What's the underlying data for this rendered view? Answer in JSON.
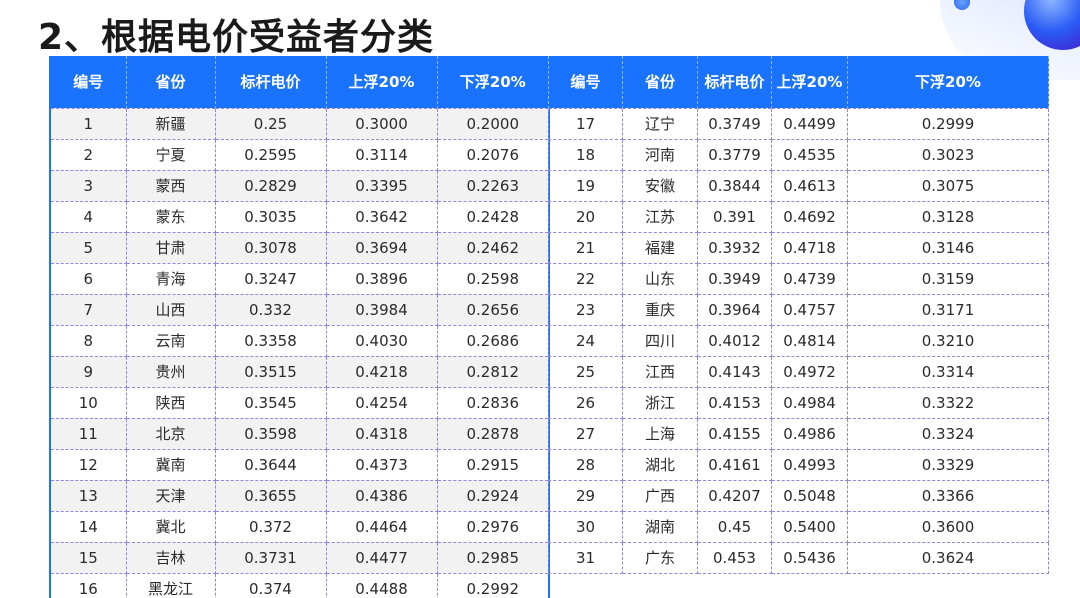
{
  "page": {
    "title": "2、根据电价受益者分类"
  },
  "table_left": {
    "headers": [
      "编号",
      "省份",
      "标杆电价",
      "上浮20%",
      "下浮20%"
    ],
    "rows": [
      [
        "1",
        "新疆",
        "0.25",
        "0.3000",
        "0.2000"
      ],
      [
        "2",
        "宁夏",
        "0.2595",
        "0.3114",
        "0.2076"
      ],
      [
        "3",
        "蒙西",
        "0.2829",
        "0.3395",
        "0.2263"
      ],
      [
        "4",
        "蒙东",
        "0.3035",
        "0.3642",
        "0.2428"
      ],
      [
        "5",
        "甘肃",
        "0.3078",
        "0.3694",
        "0.2462"
      ],
      [
        "6",
        "青海",
        "0.3247",
        "0.3896",
        "0.2598"
      ],
      [
        "7",
        "山西",
        "0.332",
        "0.3984",
        "0.2656"
      ],
      [
        "8",
        "云南",
        "0.3358",
        "0.4030",
        "0.2686"
      ],
      [
        "9",
        "贵州",
        "0.3515",
        "0.4218",
        "0.2812"
      ],
      [
        "10",
        "陕西",
        "0.3545",
        "0.4254",
        "0.2836"
      ],
      [
        "11",
        "北京",
        "0.3598",
        "0.4318",
        "0.2878"
      ],
      [
        "12",
        "冀南",
        "0.3644",
        "0.4373",
        "0.2915"
      ],
      [
        "13",
        "天津",
        "0.3655",
        "0.4386",
        "0.2924"
      ],
      [
        "14",
        "冀北",
        "0.372",
        "0.4464",
        "0.2976"
      ],
      [
        "15",
        "吉林",
        "0.3731",
        "0.4477",
        "0.2985"
      ],
      [
        "16",
        "黑龙江",
        "0.374",
        "0.4488",
        "0.2992"
      ]
    ]
  },
  "table_right": {
    "headers": [
      "编号",
      "省份",
      "标杆电价",
      "上浮20%",
      "下浮20%"
    ],
    "rows": [
      [
        "17",
        "辽宁",
        "0.3749",
        "0.4499",
        "0.2999"
      ],
      [
        "18",
        "河南",
        "0.3779",
        "0.4535",
        "0.3023"
      ],
      [
        "19",
        "安徽",
        "0.3844",
        "0.4613",
        "0.3075"
      ],
      [
        "20",
        "江苏",
        "0.391",
        "0.4692",
        "0.3128"
      ],
      [
        "21",
        "福建",
        "0.3932",
        "0.4718",
        "0.3146"
      ],
      [
        "22",
        "山东",
        "0.3949",
        "0.4739",
        "0.3159"
      ],
      [
        "23",
        "重庆",
        "0.3964",
        "0.4757",
        "0.3171"
      ],
      [
        "24",
        "四川",
        "0.4012",
        "0.4814",
        "0.3210"
      ],
      [
        "25",
        "江西",
        "0.4143",
        "0.4972",
        "0.3314"
      ],
      [
        "26",
        "浙江",
        "0.4153",
        "0.4984",
        "0.3322"
      ],
      [
        "27",
        "上海",
        "0.4155",
        "0.4986",
        "0.3324"
      ],
      [
        "28",
        "湖北",
        "0.4161",
        "0.4993",
        "0.3329"
      ],
      [
        "29",
        "广西",
        "0.4207",
        "0.5048",
        "0.3366"
      ],
      [
        "30",
        "湖南",
        "0.45",
        "0.5400",
        "0.3600"
      ],
      [
        "31",
        "广东",
        "0.453",
        "0.5436",
        "0.3624"
      ]
    ]
  },
  "theme": {
    "header_bg": "#1a73ff",
    "header_text": "#ffffff",
    "alt_row_bg": "#f2f2f2",
    "grid_line": "#8f86e6"
  }
}
